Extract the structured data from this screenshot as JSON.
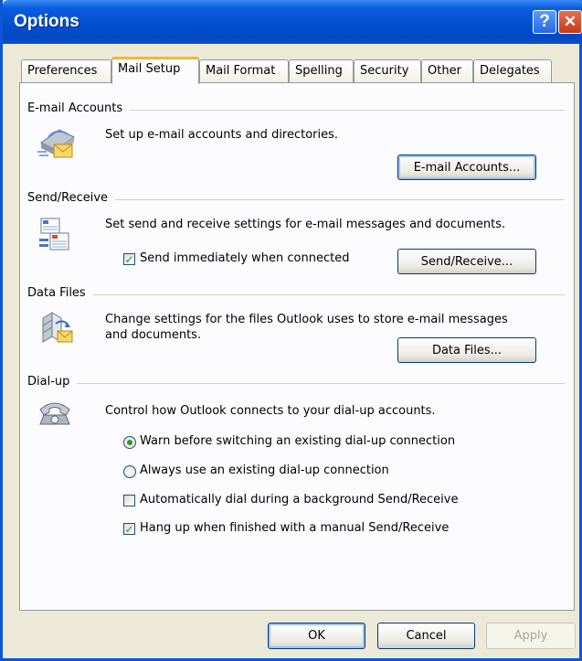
{
  "window": {
    "title": "Options"
  },
  "titlebar": {
    "help_glyph": "?",
    "close_glyph": "✕"
  },
  "tabs": [
    {
      "label": "Preferences"
    },
    {
      "label": "Mail Setup"
    },
    {
      "label": "Mail Format"
    },
    {
      "label": "Spelling"
    },
    {
      "label": "Security"
    },
    {
      "label": "Other"
    },
    {
      "label": "Delegates"
    }
  ],
  "active_tab": "Mail Setup",
  "email_accounts": {
    "heading": "E-mail Accounts",
    "description": "Set up e-mail accounts and directories.",
    "button": "E-mail Accounts...",
    "icon": "email-accounts-icon"
  },
  "send_receive": {
    "heading": "Send/Receive",
    "description": "Set send and receive settings for e-mail messages and documents.",
    "checkbox_label": "Send immediately when connected",
    "checkbox_checked": true,
    "button": "Send/Receive...",
    "icon": "send-receive-icon"
  },
  "data_files": {
    "heading": "Data Files",
    "description_line1": "Change settings for the files Outlook uses to store e-mail messages",
    "description_line2": "and documents.",
    "button": "Data Files...",
    "icon": "data-files-icon"
  },
  "dialup": {
    "heading": "Dial-up",
    "description": "Control how Outlook connects to your dial-up accounts.",
    "radio_warn": "Warn before switching an existing dial-up connection",
    "radio_always": "Always use an existing dial-up connection",
    "selected_radio": "warn",
    "check_auto_dial": "Automatically dial during a background Send/Receive",
    "check_auto_dial_checked": false,
    "check_hang_up": "Hang up when finished with a manual Send/Receive",
    "check_hang_up_checked": true,
    "icon": "telephone-icon"
  },
  "footer": {
    "ok": "OK",
    "cancel": "Cancel",
    "apply": "Apply"
  },
  "colors": {
    "titlebar_blue": "#0250d0",
    "active_tab_accent": "#f7b43a",
    "check_green": "#21a121",
    "dialog_bg": "#ece9d8"
  }
}
